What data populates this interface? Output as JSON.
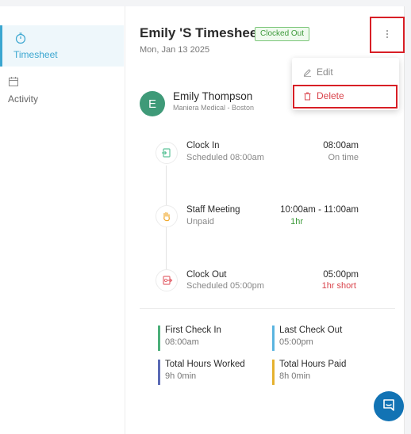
{
  "sidebar": {
    "items": [
      {
        "label": "Timesheet",
        "icon": "stopwatch-icon",
        "active": true
      },
      {
        "label": "Activity",
        "icon": "calendar-icon",
        "active": false
      }
    ]
  },
  "header": {
    "title": "Emily 'S Timesheet",
    "status_badge": "Clocked Out",
    "date": "Mon, Jan 13 2025"
  },
  "menu": {
    "items": [
      {
        "label": "Edit",
        "icon": "pencil-icon"
      },
      {
        "label": "Delete",
        "icon": "trash-icon"
      }
    ]
  },
  "employee": {
    "initial": "E",
    "name": "Emily Thompson",
    "location": "Maniera Medical - Boston"
  },
  "timeline": [
    {
      "label": "Clock In",
      "sub": "Scheduled 08:00am",
      "time": "08:00am",
      "note": "On time",
      "note_color": "#888888",
      "icon": "clock-in-icon"
    },
    {
      "label": "Staff Meeting",
      "sub": "Unpaid",
      "time": "10:00am - 11:00am",
      "note": "1hr",
      "note_color": "#3d9a3a",
      "icon": "hand-icon"
    },
    {
      "label": "Clock Out",
      "sub": "Scheduled 05:00pm",
      "time": "05:00pm",
      "note": "1hr short",
      "note_color": "#d9434b",
      "icon": "clock-out-icon"
    }
  ],
  "stats": [
    {
      "label": "First Check In",
      "value": "08:00am",
      "color": "#4caf7a"
    },
    {
      "label": "Last Check Out",
      "value": "05:00pm",
      "color": "#5ab4e0"
    },
    {
      "label": "Total Hours Worked",
      "value": "9h 0min",
      "color": "#5b6bb5"
    },
    {
      "label": "Total Hours Paid",
      "value": "8h 0min",
      "color": "#e5b12e"
    }
  ],
  "colors": {
    "accent": "#3aa6d0",
    "highlight": "#d81f26",
    "avatar": "#3f9a78",
    "chat": "#1273b4"
  }
}
